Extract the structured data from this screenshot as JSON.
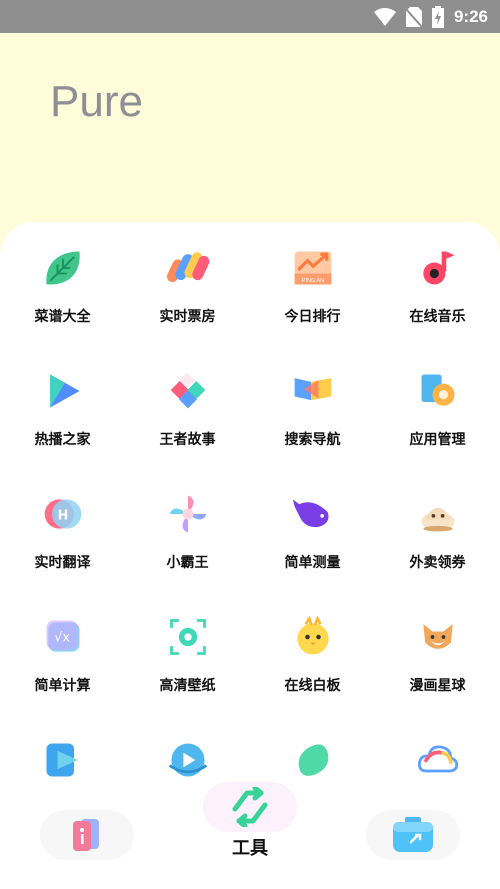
{
  "status": {
    "time": "9:26",
    "icons": [
      "wifi-icon",
      "no-sim-icon",
      "battery-charging-icon"
    ]
  },
  "header": {
    "title": "Pure"
  },
  "apps": [
    {
      "label": "菜谱大全",
      "icon": "leaf-icon"
    },
    {
      "label": "实时票房",
      "icon": "color-stripes-icon"
    },
    {
      "label": "今日排行",
      "icon": "trend-chart-icon"
    },
    {
      "label": "在线音乐",
      "icon": "music-note-icon"
    },
    {
      "label": "热播之家",
      "icon": "play-icon"
    },
    {
      "label": "王者故事",
      "icon": "diamond-cluster-icon"
    },
    {
      "label": "搜索导航",
      "icon": "flag-icon"
    },
    {
      "label": "应用管理",
      "icon": "gear-puzzle-icon"
    },
    {
      "label": "实时翻译",
      "icon": "translate-h-icon"
    },
    {
      "label": "小霸王",
      "icon": "pinwheel-icon"
    },
    {
      "label": "简单测量",
      "icon": "dolphin-icon"
    },
    {
      "label": "外卖领券",
      "icon": "dumpling-icon"
    },
    {
      "label": "简单计算",
      "icon": "sqrt-calculator-icon"
    },
    {
      "label": "高清壁纸",
      "icon": "flower-frame-icon"
    },
    {
      "label": "在线白板",
      "icon": "chick-icon"
    },
    {
      "label": "漫画星球",
      "icon": "fox-icon"
    },
    {
      "label": "",
      "icon": "video-play-icon"
    },
    {
      "label": "",
      "icon": "whale-play-icon"
    },
    {
      "label": "",
      "icon": "bean-icon"
    },
    {
      "label": "",
      "icon": "cloud-icon"
    }
  ],
  "bottom_nav": {
    "center_label": "工具",
    "left_icon": "cards-icon",
    "center_icon": "swap-arrows-icon",
    "right_icon": "toolbox-icon"
  }
}
